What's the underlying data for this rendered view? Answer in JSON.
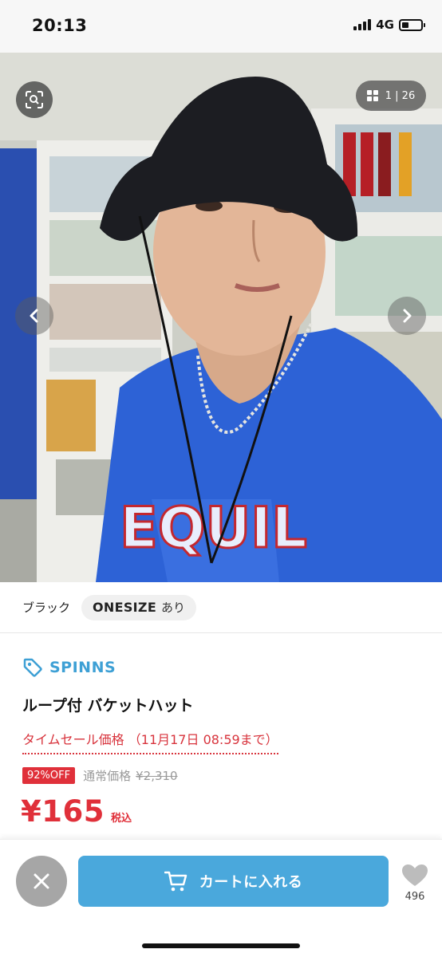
{
  "status_bar": {
    "time": "20:13",
    "network": "4G",
    "battery_level": 0.35
  },
  "gallery": {
    "counter": "1 | 26",
    "icons": {
      "scan": "scan-icon",
      "grid": "grid-icon",
      "prev": "chevron-left-icon",
      "next": "chevron-right-icon"
    },
    "photo_description_text": ""
  },
  "variant": {
    "color": "ブラック",
    "size": "ONESIZE",
    "stock": "あり"
  },
  "product": {
    "brand": "SPINNS",
    "title": "ループ付 バケットハット",
    "sale_label": "タイムセール価格 （11月17日 08:59まで）",
    "discount": "92%OFF",
    "regular_label": "通常価格",
    "regular_price": "¥2,310",
    "sale_price": "¥165",
    "tax_label": "税込"
  },
  "actions": {
    "cart_label": "カートに入れる",
    "favorite_count": "496"
  },
  "colors": {
    "accent": "#4aa8dc",
    "brand": "#3ea0d5",
    "sale": "#e0303a",
    "close": "#a6a6a6"
  }
}
